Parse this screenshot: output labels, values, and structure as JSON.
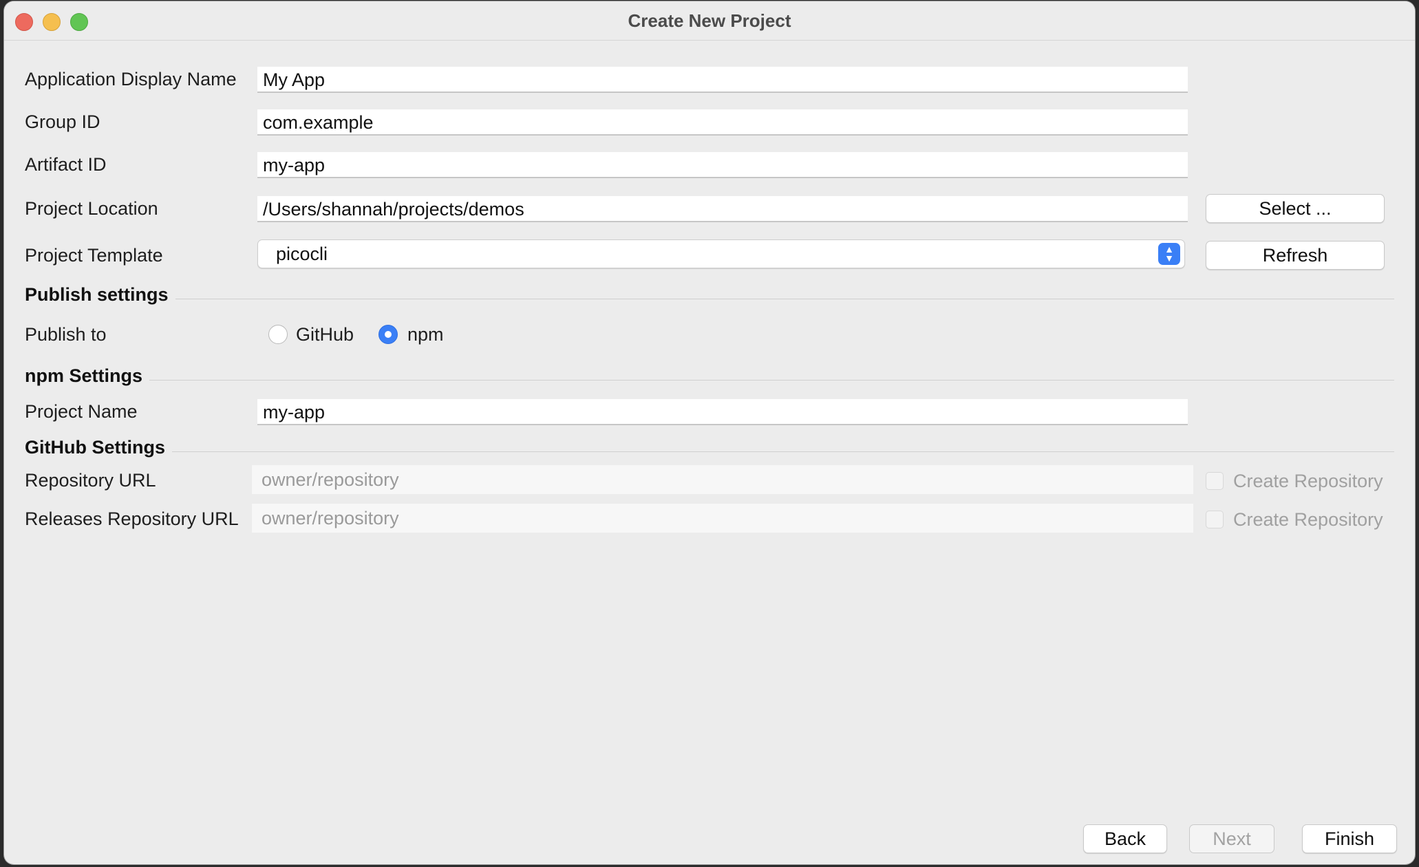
{
  "window": {
    "title": "Create New Project"
  },
  "form": {
    "app_name": {
      "label": "Application Display Name",
      "value": "My App"
    },
    "group_id": {
      "label": "Group ID",
      "value": "com.example"
    },
    "artifact_id": {
      "label": "Artifact ID",
      "value": "my-app"
    },
    "project_location": {
      "label": "Project Location",
      "value": "/Users/shannah/projects/demos",
      "button": "Select ..."
    },
    "project_template": {
      "label": "Project Template",
      "value": "picocli",
      "button": "Refresh"
    }
  },
  "publish": {
    "heading": "Publish settings",
    "label": "Publish to",
    "options": [
      {
        "label": "GitHub",
        "checked": false
      },
      {
        "label": "npm",
        "checked": true
      }
    ]
  },
  "npm": {
    "heading": "npm Settings",
    "project_name": {
      "label": "Project Name",
      "value": "my-app"
    }
  },
  "github": {
    "heading": "GitHub Settings",
    "repo_url": {
      "label": "Repository URL",
      "placeholder": "owner/repository",
      "checkbox": "Create Repository"
    },
    "releases_url": {
      "label": "Releases Repository URL",
      "placeholder": "owner/repository",
      "checkbox": "Create Repository"
    }
  },
  "footer": {
    "back": "Back",
    "next": "Next",
    "finish": "Finish"
  },
  "colors": {
    "accent": "#3a7ff6",
    "window_bg": "#ececec"
  }
}
